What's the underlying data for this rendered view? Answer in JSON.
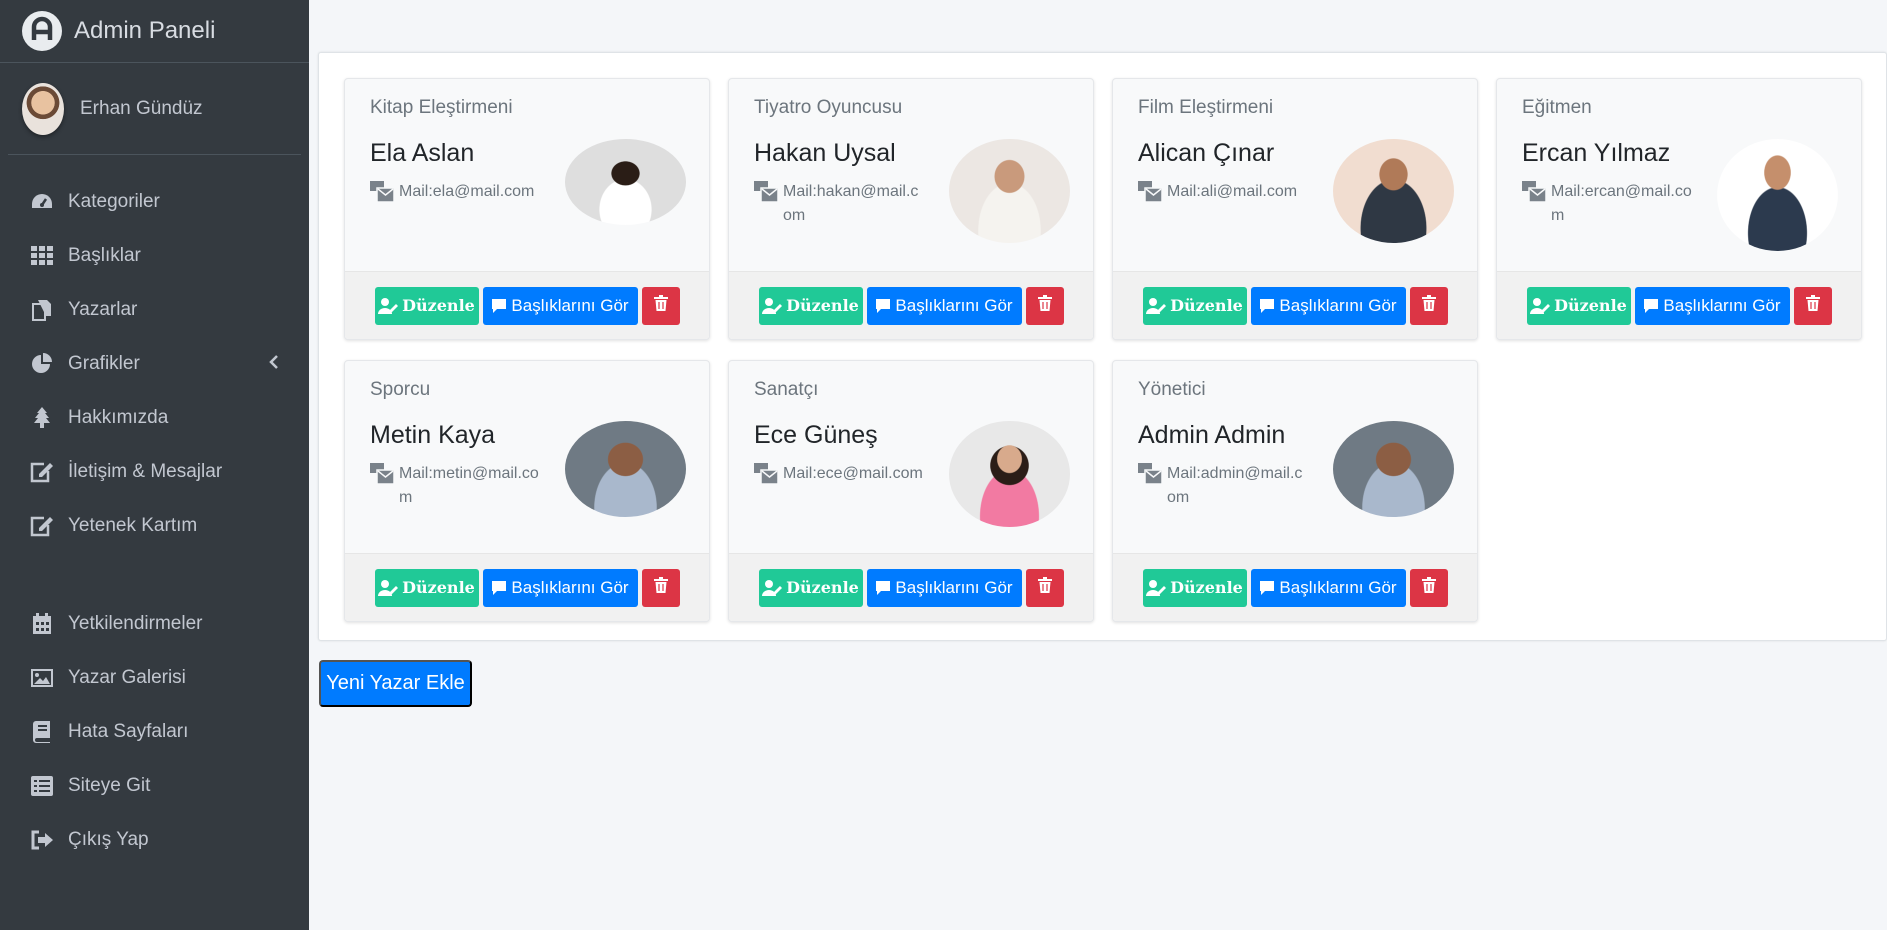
{
  "brand": {
    "title": "Admin Paneli",
    "logo_icon": "brand-logo-icon"
  },
  "user": {
    "name": "Erhan Gündüz"
  },
  "sidebar": {
    "items": [
      {
        "label": "Kategoriler",
        "icon": "tachometer-icon"
      },
      {
        "label": "Başlıklar",
        "icon": "grid-icon"
      },
      {
        "label": "Yazarlar",
        "icon": "copy-icon"
      },
      {
        "label": "Grafikler",
        "icon": "pie-chart-icon"
      },
      {
        "label": "Hakkımızda",
        "icon": "tree-icon"
      },
      {
        "label": "İletişim & Mesajlar",
        "icon": "edit-icon"
      },
      {
        "label": "Yetenek Kartım",
        "icon": "edit-icon"
      },
      {
        "label": "Yetkilendirmeler",
        "icon": "calendar-icon"
      },
      {
        "label": "Yazar Galerisi",
        "icon": "image-icon"
      },
      {
        "label": "Hata Sayfaları",
        "icon": "book-icon"
      },
      {
        "label": "Siteye Git",
        "icon": "list-icon"
      },
      {
        "label": "Çıkış Yap",
        "icon": "sign-out-icon"
      }
    ]
  },
  "writers": [
    {
      "role": "Kitap Eleştirmeni",
      "name": "Ela Aslan",
      "mail": "Mail:ela@mail.com"
    },
    {
      "role": "Tiyatro Oyuncusu",
      "name": "Hakan Uysal",
      "mail": "Mail:hakan@mail.com"
    },
    {
      "role": "Film Eleştirmeni",
      "name": "Alican Çınar",
      "mail": "Mail:ali@mail.com"
    },
    {
      "role": "Eğitmen",
      "name": "Ercan Yılmaz",
      "mail": "Mail:ercan@mail.com"
    },
    {
      "role": "Sporcu",
      "name": "Metin Kaya",
      "mail": "Mail:metin@mail.com"
    },
    {
      "role": "Sanatçı",
      "name": "Ece Güneş",
      "mail": "Mail:ece@mail.com"
    },
    {
      "role": "Yönetici",
      "name": "Admin Admin",
      "mail": "Mail:admin@mail.com"
    }
  ],
  "buttons": {
    "edit": "Düzenle",
    "topics": "Başlıklarını Gör"
  },
  "add_button": "Yeni Yazar Ekle",
  "colors": {
    "sidebar": "#343a40",
    "primary": "#007bff",
    "success": "#20c997",
    "danger": "#dc3545"
  }
}
